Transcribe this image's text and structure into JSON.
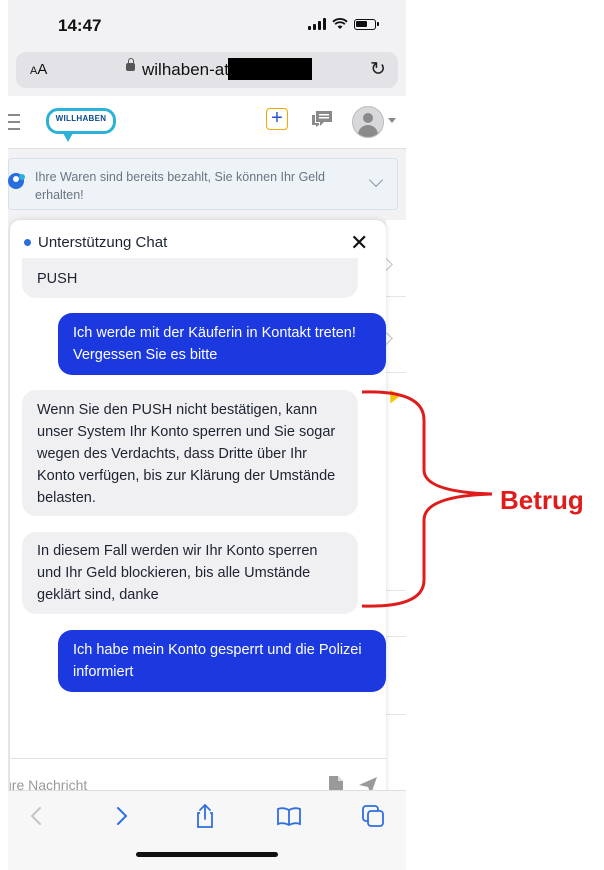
{
  "status_bar": {
    "time": "14:47"
  },
  "browser": {
    "aa_small": "A",
    "aa_large": "A",
    "url": "wilhaben-at."
  },
  "header": {
    "logo_text": "WILLHABEN",
    "plus_label": "+"
  },
  "notice": {
    "text": "Ihre Waren sind bereits bezahlt, Sie können Ihr Geld erhalten!"
  },
  "chat": {
    "title": "Unterstützung Chat",
    "close": "✕",
    "messages": [
      {
        "direction": "in",
        "text": "PUSH"
      },
      {
        "direction": "out",
        "text": "Ich werde mit der Käuferin in Kontakt treten! Vergessen Sie es bitte"
      },
      {
        "direction": "in",
        "text": "Wenn Sie den PUSH nicht bestätigen, kann unser System Ihr Konto sperren und Sie sogar wegen des Verdachts, dass Dritte über Ihr Konto verfügen, bis zur Klärung der Umstände belasten."
      },
      {
        "direction": "in",
        "text": "In diesem Fall werden wir Ihr Konto sperren und Ihr Geld blockieren, bis alle Umstände geklärt sind, danke"
      },
      {
        "direction": "out",
        "text": "Ich habe mein Konto gesperrt und die Polizei informiert"
      }
    ],
    "input_placeholder": "ure Nachricht"
  },
  "annotation": {
    "label": "Betrug",
    "color": "#e01b1b"
  },
  "colors": {
    "outgoing_bubble": "#1c39e0",
    "incoming_bubble": "#f0f0f2",
    "logo": "#2cb1d8",
    "toolbar_icons": "#2f6fe0"
  }
}
